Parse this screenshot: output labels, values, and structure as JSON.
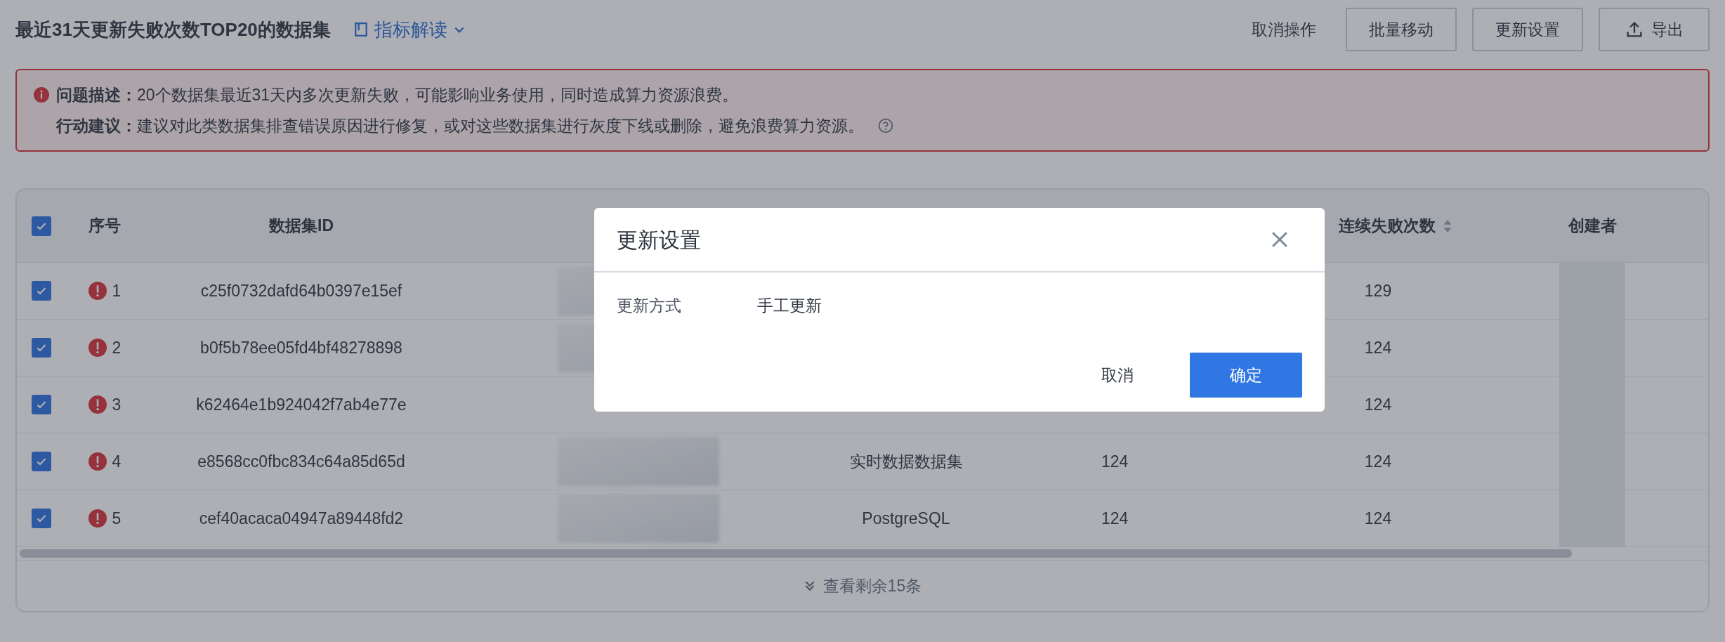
{
  "header": {
    "title": "最近31天更新失败次数TOP20的数据集",
    "metric_link": "指标解读"
  },
  "actions": [
    {
      "kind": "text",
      "label": "取消操作"
    },
    {
      "kind": "outlined",
      "label": "批量移动"
    },
    {
      "kind": "outlined",
      "label": "更新设置"
    },
    {
      "kind": "export",
      "label": "导出"
    }
  ],
  "alert": {
    "lines": [
      {
        "label": "问题描述：",
        "text": "20个数据集最近31天内多次更新失败，可能影响业务使用，同时造成算力资源浪费。",
        "help": false
      },
      {
        "label": "行动建议：",
        "text": "建议对此类数据集排查错误原因进行修复，或对这些数据集进行灰度下线或删除，避免浪费算力资源。",
        "help": true
      }
    ]
  },
  "table": {
    "select_all_checked": true,
    "columns": [
      {
        "label": "序号",
        "sortable": false
      },
      {
        "label": "数据集ID",
        "sortable": false
      },
      {
        "label": "连续失败次数",
        "sortable": true
      },
      {
        "label": "创建者",
        "sortable": false
      }
    ],
    "rows": [
      {
        "checked": true,
        "warning": true,
        "index": "1",
        "dataset_id": "c25f0732dafd64b0397e15ef",
        "name_blurred": true,
        "failures": "129"
      },
      {
        "checked": true,
        "warning": true,
        "index": "2",
        "dataset_id": "b0f5b78ee05fd4bf48278898",
        "name_blurred": true,
        "failures": "124"
      },
      {
        "checked": true,
        "warning": true,
        "index": "3",
        "dataset_id": "k62464e1b924042f7ab4e77e",
        "name_blurred": false,
        "failures": "124"
      },
      {
        "checked": true,
        "warning": true,
        "index": "4",
        "dataset_id": "e8568cc0fbc834c64a85d65d",
        "name_blurred": true,
        "column_4": "实时数据数据集",
        "column_5": "124",
        "failures": "124"
      },
      {
        "checked": true,
        "warning": true,
        "index": "5",
        "dataset_id": "cef40acaca04947a89448fd2",
        "name_blurred": true,
        "column_4": "PostgreSQL",
        "column_5": "124",
        "failures": "124"
      }
    ],
    "more_link": "查看剩余15条"
  },
  "dialog": {
    "title": "更新设置",
    "fields": [
      {
        "label": "更新方式",
        "value": "手工更新"
      }
    ],
    "cancel": "取消",
    "confirm": "确定"
  }
}
